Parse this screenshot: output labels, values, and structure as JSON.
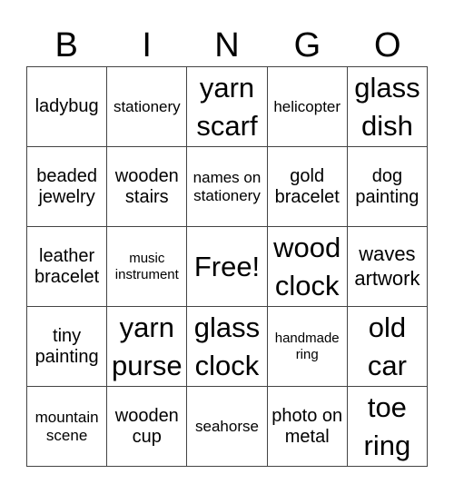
{
  "header": [
    "B",
    "I",
    "N",
    "G",
    "O"
  ],
  "cells": [
    {
      "text": "ladybug",
      "size": "s3"
    },
    {
      "text": "stationery",
      "size": "s2"
    },
    {
      "text": "yarn scarf",
      "size": "s5"
    },
    {
      "text": "helicopter",
      "size": "s2"
    },
    {
      "text": "glass dish",
      "size": "s5"
    },
    {
      "text": "beaded jewelry",
      "size": "s3"
    },
    {
      "text": "wooden stairs",
      "size": "s3"
    },
    {
      "text": "names on stationery",
      "size": "s2"
    },
    {
      "text": "gold bracelet",
      "size": "s3"
    },
    {
      "text": "dog painting",
      "size": "s3"
    },
    {
      "text": "leather bracelet",
      "size": "s3"
    },
    {
      "text": "music instrument",
      "size": "s1"
    },
    {
      "text": "Free!",
      "size": "s5"
    },
    {
      "text": "wood clock",
      "size": "s5"
    },
    {
      "text": "waves artwork",
      "size": "s4"
    },
    {
      "text": "tiny painting",
      "size": "s3"
    },
    {
      "text": "yarn purse",
      "size": "s5"
    },
    {
      "text": "glass clock",
      "size": "s5"
    },
    {
      "text": "handmade ring",
      "size": "s1"
    },
    {
      "text": "old car",
      "size": "s5"
    },
    {
      "text": "mountain scene",
      "size": "s2"
    },
    {
      "text": "wooden cup",
      "size": "s3"
    },
    {
      "text": "seahorse",
      "size": "s2"
    },
    {
      "text": "photo on metal",
      "size": "s3"
    },
    {
      "text": "toe ring",
      "size": "s5"
    }
  ]
}
